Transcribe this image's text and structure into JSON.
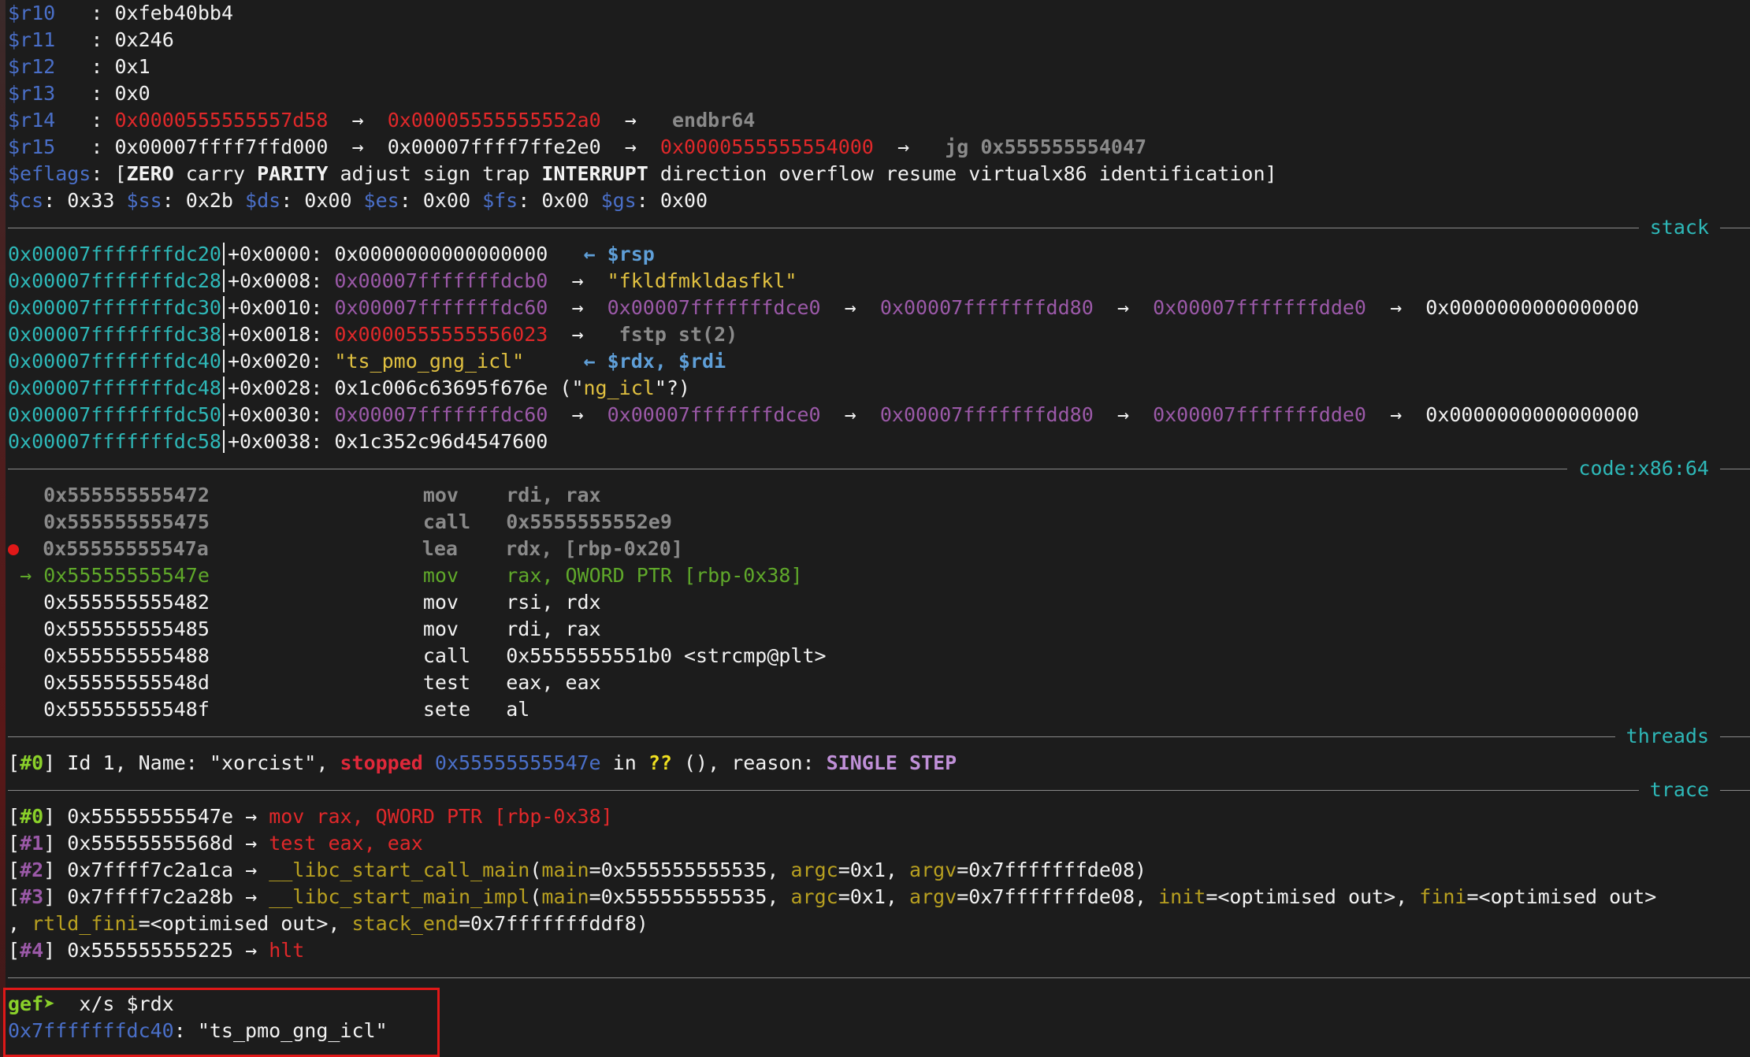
{
  "registers": [
    {
      "name": "$r10",
      "value": "0xfeb40bb4"
    },
    {
      "name": "$r11",
      "value": "0x246"
    },
    {
      "name": "$r12",
      "value": "0x1"
    },
    {
      "name": "$r13",
      "value": "0x0"
    }
  ],
  "r14": {
    "name": "$r14",
    "v1": "0x0000555555557d58",
    "v2": "0x00005555555552a0",
    "v3": "endbr64"
  },
  "r15": {
    "name": "$r15",
    "v1": "0x00007ffff7ffd000",
    "v2": "0x00007ffff7ffe2e0",
    "v3": "0x0000555555554000",
    "v4": "jg 0x555555554047"
  },
  "eflags": {
    "name": "$eflags",
    "open": "[",
    "zero": "ZERO",
    "carry": " carry ",
    "parity": "PARITY",
    "adjust": " adjust sign trap ",
    "interrupt": "INTERRUPT",
    "rest": " direction overflow resume virtualx86 identification]"
  },
  "segs": {
    "cs": "$cs",
    "csv": ": 0x33 ",
    "ss": "$ss",
    "ssv": ": 0x2b ",
    "ds": "$ds",
    "dsv": ": 0x00 ",
    "es": "$es",
    "esv": ": 0x00 ",
    "fs": "$fs",
    "fsv": ": 0x00 ",
    "gs": "$gs",
    "gsv": ": 0x00"
  },
  "arrow": "→",
  "larrow": "←",
  "sections": {
    "stack": "stack",
    "code": "code:x86:64",
    "threads": "threads",
    "trace": "trace"
  },
  "stack": [
    {
      "addr": "0x00007fffffffdc20",
      "off": "+0x0000: ",
      "val": "0x0000000000000000",
      "note": "$rsp"
    },
    {
      "addr": "0x00007fffffffdc28",
      "off": "+0x0008: ",
      "val": "0x00007fffffffdcb0",
      "s1": "\"fkldfmkldasfkl\""
    },
    {
      "addr": "0x00007fffffffdc30",
      "off": "+0x0010: ",
      "val": "0x00007fffffffdc60",
      "c1": "0x00007fffffffdce0",
      "c2": "0x00007fffffffdd80",
      "c3": "0x00007fffffffdde0",
      "c4": "0x0000000000000000"
    },
    {
      "addr": "0x00007fffffffdc38",
      "off": "+0x0018: ",
      "val": "0x0000555555556023",
      "g1": "fstp st(2)"
    },
    {
      "addr": "0x00007fffffffdc40",
      "off": "+0x0020: ",
      "val": "\"ts_pmo_gng_icl\"",
      "note": "$rdx, $rdi"
    },
    {
      "addr": "0x00007fffffffdc48",
      "off": "+0x0028: ",
      "val": "0x1c006c63695f676e",
      "p1": " (\"",
      "p2": "ng_icl",
      "p3": "\"?)"
    },
    {
      "addr": "0x00007fffffffdc50",
      "off": "+0x0030: ",
      "val": "0x00007fffffffdc60",
      "c1": "0x00007fffffffdce0",
      "c2": "0x00007fffffffdd80",
      "c3": "0x00007fffffffdde0",
      "c4": "0x0000000000000000"
    },
    {
      "addr": "0x00007fffffffdc58",
      "off": "+0x0038: ",
      "val": "0x1c352c96d4547600"
    }
  ],
  "code": [
    {
      "addr": "0x555555555472",
      "op": "mov",
      "args": "rdi, rax"
    },
    {
      "addr": "0x555555555475",
      "op": "call",
      "args": "0x5555555552e9"
    },
    {
      "addr": "0x55555555547a",
      "op": "lea",
      "args": "rdx, [rbp-0x20]"
    },
    {
      "addr": "0x55555555547e",
      "op": "mov",
      "args": "rax, QWORD PTR [rbp-0x38]"
    },
    {
      "addr": "0x555555555482",
      "op": "mov",
      "args": "rsi, rdx"
    },
    {
      "addr": "0x555555555485",
      "op": "mov",
      "args": "rdi, rax"
    },
    {
      "addr": "0x555555555488",
      "op": "call",
      "args": "0x5555555551b0 <strcmp@plt>"
    },
    {
      "addr": "0x55555555548d",
      "op": "test",
      "args": "eax, eax"
    },
    {
      "addr": "0x55555555548f",
      "op": "sete",
      "args": "al"
    }
  ],
  "thread": {
    "idx": "#0",
    "pre": " Id 1, Name: \"xorcist\", ",
    "state": "stopped",
    "addr": "0x55555555547e",
    "in": " in ",
    "fn": "??",
    "post": " (), reason: ",
    "reason": "SINGLE STEP"
  },
  "trace": [
    {
      "idx": "#0",
      "addr": " 0x55555555547e ",
      "ins": "mov rax, QWORD PTR [rbp-0x38]"
    },
    {
      "idx": "#1",
      "addr": " 0x55555555568d ",
      "ins": "test eax, eax"
    },
    {
      "idx": "#2",
      "addr": " 0x7ffff7c2a1ca ",
      "fn": "__libc_start_call_main",
      "a": "(",
      "k1": "main",
      "v1": "=0x555555555535, ",
      "k2": "argc",
      "v2": "=0x1, ",
      "k3": "argv",
      "v3": "=0x7fffffffde08)"
    },
    {
      "idx": "#3",
      "addr": " 0x7ffff7c2a28b ",
      "fn": "__libc_start_main_impl",
      "a": "(",
      "k1": "main",
      "v1": "=0x555555555535, ",
      "k2": "argc",
      "v2": "=0x1, ",
      "k3": "argv",
      "v3": "=0x7fffffffde08, ",
      "k4": "init",
      "v4": "=<optimised out>, ",
      "k5": "fini",
      "v5": "=<optimised out>"
    },
    {
      "cont_a": ", ",
      "k6": "rtld_fini",
      "v6": "=<optimised out>, ",
      "k7": "stack_end",
      "v7": "=0x7fffffffddf8)"
    },
    {
      "idx": "#4",
      "addr": " 0x555555555225 ",
      "ins": "hlt"
    }
  ],
  "prompt": {
    "label": "gef➤",
    "cmd": "  x/s $rdx"
  },
  "result": {
    "addr": "0x7fffffffdc40",
    "val": ": \"ts_pmo_gng_icl\""
  }
}
